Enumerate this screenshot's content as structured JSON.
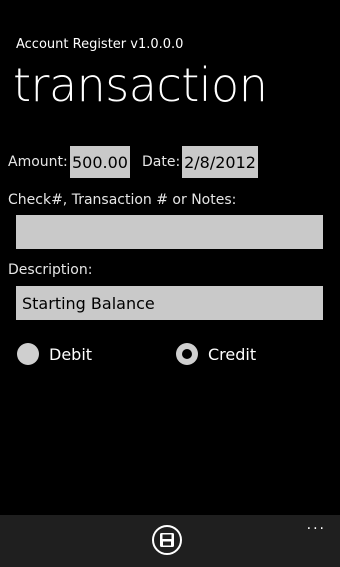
{
  "app": {
    "title": "Account Register v1.0.0.0",
    "page_title": "transaction"
  },
  "form": {
    "amount_label": "Amount:",
    "amount_value": "500.00",
    "date_label": "Date:",
    "date_value": "2/8/2012",
    "check_label": "Check#, Transaction # or Notes:",
    "check_value": "",
    "description_label": "Description:",
    "description_value": "Starting Balance",
    "debit_label": "Debit",
    "credit_label": "Credit",
    "selected_type": "Credit"
  },
  "appbar": {
    "save_icon": "save-icon",
    "more_label": "..."
  }
}
